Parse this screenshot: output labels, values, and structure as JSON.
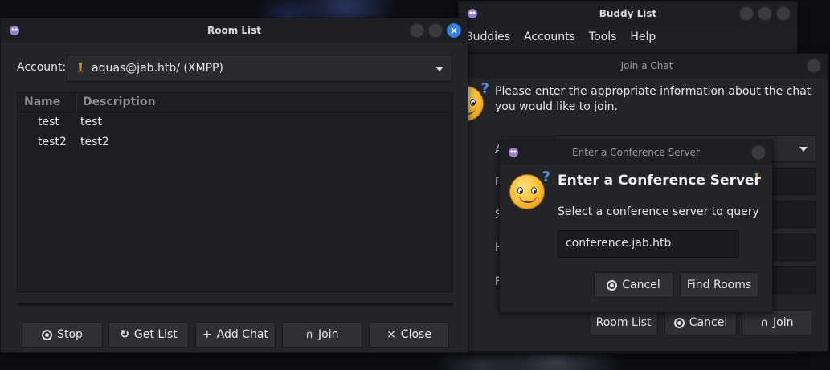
{
  "buddy_list": {
    "title": "Buddy List",
    "menu": [
      "Buddies",
      "Accounts",
      "Tools",
      "Help"
    ]
  },
  "join_chat": {
    "title": "Join a Chat",
    "message": "Please enter the appropriate information about the chat you would like to join.",
    "buttons": {
      "room_list": "Room List",
      "cancel": "Cancel",
      "join": "Join"
    }
  },
  "room_list": {
    "title": "Room List",
    "account_label": "Account:",
    "account_value": "aquas@jab.htb/ (XMPP)",
    "columns": {
      "name": "Name",
      "description": "Description"
    },
    "rows": [
      {
        "name": "test",
        "description": "test"
      },
      {
        "name": "test2",
        "description": "test2"
      }
    ],
    "buttons": {
      "stop": "Stop",
      "get_list": "Get List",
      "add_chat": "Add Chat",
      "join": "Join",
      "close": "Close"
    }
  },
  "conference_dialog": {
    "title": "Enter a Conference Server",
    "heading": "Enter a Conference Server",
    "subtext": "Select a conference server to query",
    "server_value": "conference.jab.htb",
    "buttons": {
      "cancel": "Cancel",
      "find_rooms": "Find Rooms"
    }
  },
  "colors": {
    "accent": "#3584e4",
    "window_bg": "#242529",
    "titlebar_bg": "#1e1f22"
  }
}
